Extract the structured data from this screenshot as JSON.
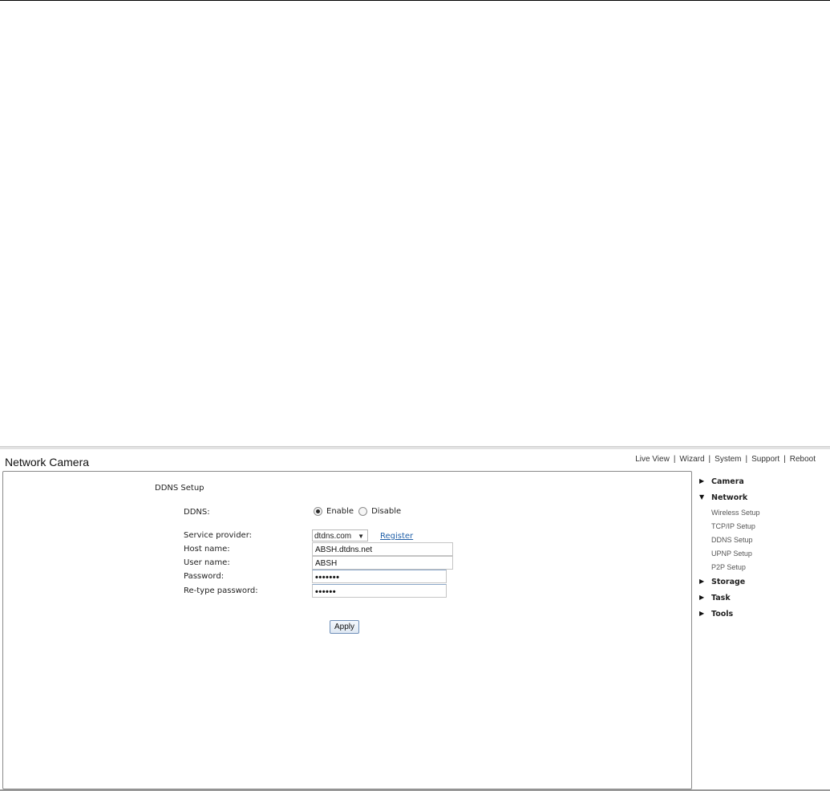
{
  "app": {
    "title": "Network Camera"
  },
  "topnav": [
    "Live View",
    "Wizard",
    "System",
    "Support",
    "Reboot"
  ],
  "page": {
    "title": "DDNS Setup",
    "ddns": {
      "label": "DDNS:",
      "options": [
        "Enable",
        "Disable"
      ],
      "selected": "Enable"
    },
    "service_provider": {
      "label": "Service provider:",
      "value": "dtdns.com",
      "register_link": "Register"
    },
    "host_name": {
      "label": "Host name:",
      "value": "ABSH.dtdns.net"
    },
    "user_name": {
      "label": "User name:",
      "value": "ABSH"
    },
    "password": {
      "label": "Password:",
      "value": "•••••••"
    },
    "retype_password": {
      "label": "Re-type password:",
      "value": "••••••"
    },
    "apply_label": "Apply"
  },
  "sidebar": {
    "sections": [
      {
        "label": "Camera",
        "expanded": false
      },
      {
        "label": "Network",
        "expanded": true,
        "items": [
          "Wireless Setup",
          "TCP/IP Setup",
          "DDNS Setup",
          "UPNP Setup",
          "P2P Setup"
        ]
      },
      {
        "label": "Storage",
        "expanded": false
      },
      {
        "label": "Task",
        "expanded": false
      },
      {
        "label": "Tools",
        "expanded": false
      }
    ]
  },
  "icons": {
    "collapsed": "triangle-right-icon",
    "expanded": "triangle-down-icon",
    "dropdown": "caret-down-icon"
  }
}
